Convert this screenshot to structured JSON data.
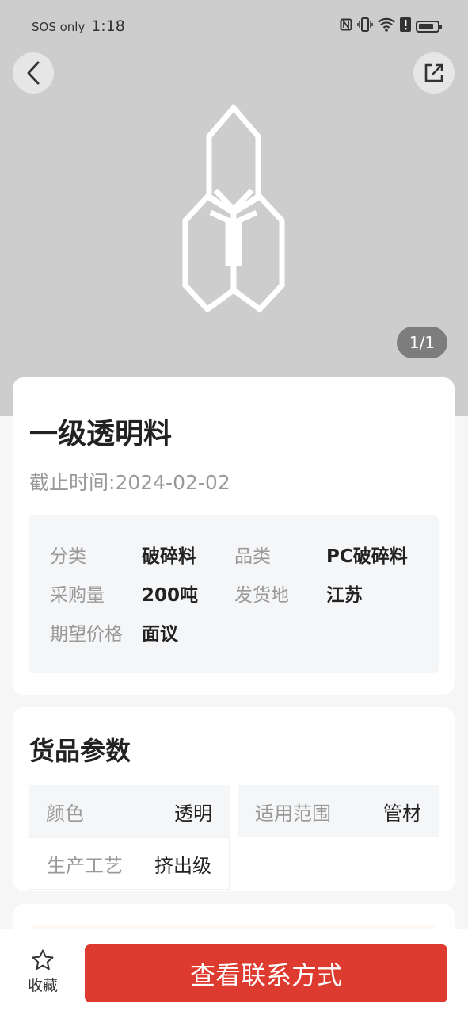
{
  "status_bar": {
    "carrier": "SOS only",
    "time": "1:18",
    "icons": [
      "nfc-icon",
      "vibrate-icon",
      "wifi-icon",
      "alert-icon",
      "battery-icon"
    ]
  },
  "hero": {
    "pager": "1/1",
    "back_icon": "chevron-left-icon",
    "share_icon": "share-external-icon"
  },
  "product": {
    "title": "一级透明料",
    "deadline_label": "截止时间:",
    "deadline_value": "2024-02-02",
    "info": {
      "category_label": "分类",
      "category_value": "破碎料",
      "type_label": "品类",
      "type_value": "PC破碎料",
      "quantity_label": "采购量",
      "quantity_value": "200吨",
      "origin_label": "发货地",
      "origin_value": "江苏",
      "price_label": "期望价格",
      "price_value": "面议"
    }
  },
  "params": {
    "title": "货品参数",
    "items": [
      {
        "label": "颜色",
        "value": "透明"
      },
      {
        "label": "适用范围",
        "value": "管材"
      },
      {
        "label": "生产工艺",
        "value": "挤出级"
      }
    ]
  },
  "bottom": {
    "favorite_label": "收藏",
    "contact_label": "查看联系方式",
    "accent_color": "#dd3b2f"
  }
}
